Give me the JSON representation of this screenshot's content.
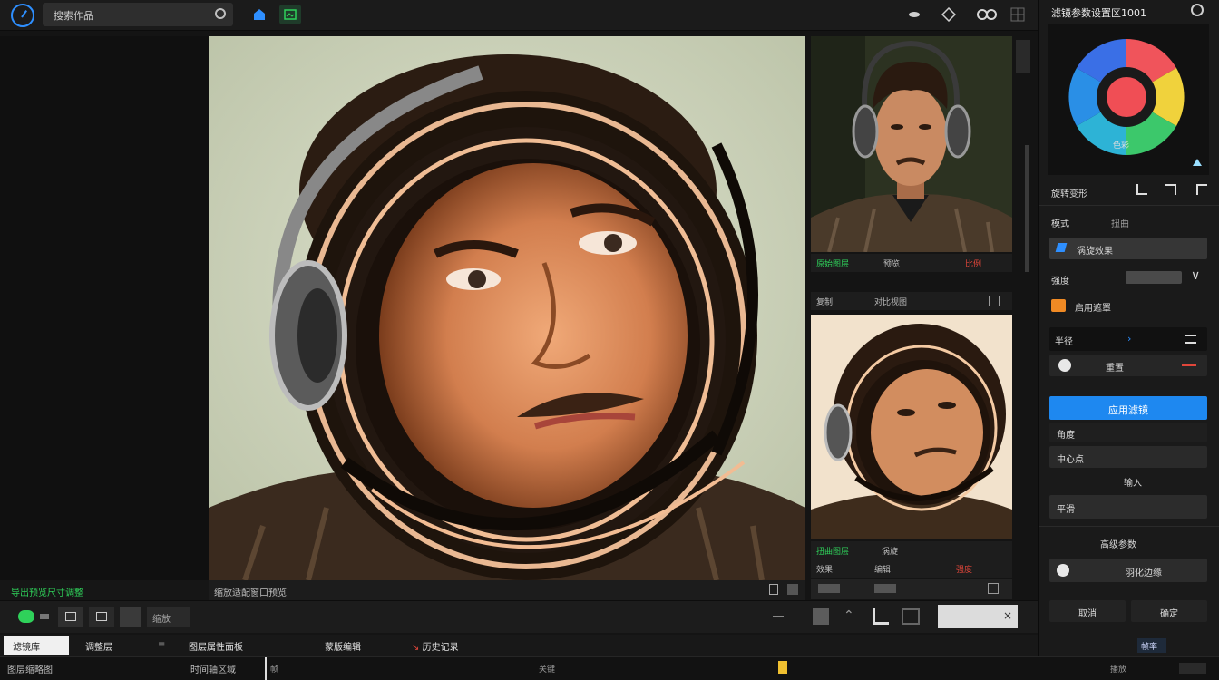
{
  "topbar": {
    "search_label": "搜索作品",
    "right_title": "滤镜参数设置区1001"
  },
  "left_status": "导出预览尺寸调整",
  "canvas": {
    "status_text": "缩放适配窗口预览"
  },
  "thumb1": {
    "bar1_left": "原始图层",
    "bar1_mid": "预览",
    "bar1_right": "比例",
    "bar2_left": "复制",
    "bar2_mid": "对比视图"
  },
  "thumb2": {
    "bar1_left": "扭曲图层",
    "bar1_mid": "涡旋",
    "bar2_left": "效果",
    "bar2_mid": "编辑",
    "bar2_right": "强度"
  },
  "right_panel": {
    "palette_caption": "色彩",
    "section_tools": "旋转变形",
    "field_mode": "模式",
    "field_mode_value": "扭曲",
    "dropdown_1": "涡旋效果",
    "field_amount": "强度",
    "checkbox_label": "启用遮罩",
    "row_param": "半径",
    "row_param_btn": "重置",
    "button_primary": "应用滤镜",
    "item_1": "角度",
    "item_2": "中心点",
    "item_3": "输入",
    "item_4": "平滑",
    "section_2": "高级参数",
    "item_5": "羽化边缘",
    "btn_cancel": "取消",
    "btn_ok": "确定"
  },
  "toolstrip": {
    "field": "缩放"
  },
  "tabs": [
    {
      "label": "滤镜库"
    },
    {
      "label": "调整层"
    },
    {
      "label": "图层属性面板"
    },
    {
      "label": "蒙版编辑"
    },
    {
      "label": "历史记录"
    }
  ],
  "timeline": {
    "left": "图层缩略图",
    "mid": "时间轴区域",
    "marker_a": "帧",
    "marker_b": "关键",
    "right": "播放",
    "right_tab": "帧率"
  },
  "colors": {
    "accent_blue": "#2e8fff",
    "accent_green": "#2fd15a",
    "primary_button": "#1e88f0",
    "danger": "#e0463a"
  }
}
